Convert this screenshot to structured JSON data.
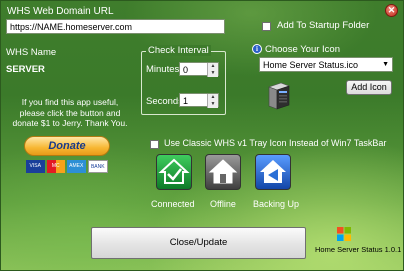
{
  "domain_url": {
    "label": "WHS Web Domain URL",
    "value": "https://NAME.homeserver.com"
  },
  "startup": {
    "label": "Add To Startup Folder",
    "checked": false
  },
  "close_icon": "close-icon",
  "whs_name": {
    "label": "WHS Name",
    "value": "SERVER"
  },
  "interval": {
    "title": "Check Interval",
    "minutes_label": "Minutes",
    "minutes_value": "0",
    "seconds_label": "Seconds",
    "seconds_value": "1"
  },
  "icon_choice": {
    "label": "Choose Your Icon",
    "selected": "Home Server Status.ico",
    "add_label": "Add Icon"
  },
  "donate": {
    "message": "If you find this app useful, please click the button and donate $1 to Jerry. Thank You.",
    "button_label": "Donate",
    "cards": [
      "VISA",
      "MC",
      "AMEX",
      "BANK"
    ]
  },
  "classic_tray": {
    "label": "Use Classic WHS v1 Tray Icon Instead of Win7 TaskBar",
    "checked": false
  },
  "statuses": [
    {
      "label": "Connected",
      "color": "#1f9a3a"
    },
    {
      "label": "Offline",
      "color": "#6e6e6e"
    },
    {
      "label": "Backing Up",
      "color": "#2a6fd6"
    }
  ],
  "close_update_label": "Close/Update",
  "version": "Home Server Status 1.0.1"
}
